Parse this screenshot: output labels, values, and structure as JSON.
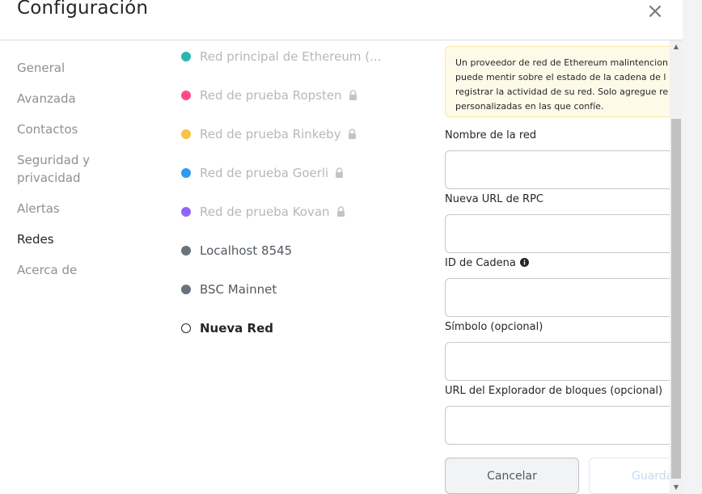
{
  "header": {
    "title": "Configuración"
  },
  "sidebar": {
    "items": [
      {
        "label": "General"
      },
      {
        "label": "Avanzada"
      },
      {
        "label": "Contactos"
      },
      {
        "label": "Seguridad y\nprivacidad"
      },
      {
        "label": "Alertas"
      },
      {
        "label": "Redes",
        "active": true
      },
      {
        "label": "Acerca de"
      }
    ]
  },
  "networks": [
    {
      "label": "Red principal de Ethereum (...",
      "color": "#29b6af",
      "locked": false
    },
    {
      "label": "Red de prueba Ropsten",
      "color": "#ff4a8d",
      "locked": true
    },
    {
      "label": "Red de prueba Rinkeby",
      "color": "#f6c343",
      "locked": true
    },
    {
      "label": "Red de prueba Goerli",
      "color": "#3099f2",
      "locked": true
    },
    {
      "label": "Red de prueba Kovan",
      "color": "#9064ff",
      "locked": true
    },
    {
      "label": "Localhost 8545",
      "color": "#6a737d",
      "locked": false
    },
    {
      "label": "BSC Mainnet",
      "color": "#6a737d",
      "locked": false
    },
    {
      "label": "Nueva Red",
      "color": "#ffffff",
      "locked": false,
      "selected": true
    }
  ],
  "form": {
    "warning": [
      "Un proveedor de red de Ethereum malintencion",
      "puede mentir sobre el estado de la cadena de l",
      "registrar la actividad de su red. Solo agregue re",
      "personalizadas en las que confíe."
    ],
    "network_name_label": "Nombre de la red",
    "rpc_url_label": "Nueva URL de RPC",
    "chain_id_label": "ID de Cadena",
    "symbol_label": "Símbolo (opcional)",
    "explorer_label": "URL del Explorador de bloques (opcional)",
    "cancel_label": "Cancelar",
    "save_label": "Guardar"
  },
  "icons": {
    "close": "close-icon",
    "lock": "lock-icon",
    "info": "info-icon"
  }
}
